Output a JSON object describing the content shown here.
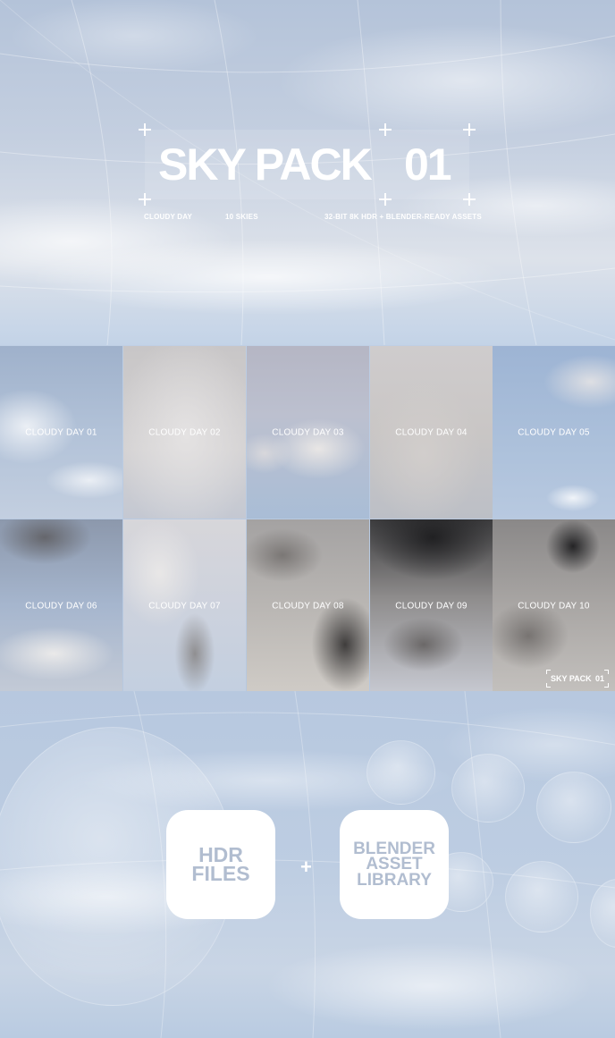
{
  "header": {
    "title_left": "SKY PACK",
    "title_right": "01",
    "subtitle_left": "CLOUDY DAY",
    "subtitle_mid": "10 SKIES",
    "subtitle_right": "32-BIT 8K HDR + BLENDER-READY ASSETS"
  },
  "tiles": [
    {
      "label": "CLOUDY DAY 01"
    },
    {
      "label": "CLOUDY DAY 02"
    },
    {
      "label": "CLOUDY DAY 03"
    },
    {
      "label": "CLOUDY DAY 04"
    },
    {
      "label": "CLOUDY DAY 05"
    },
    {
      "label": "CLOUDY DAY 06"
    },
    {
      "label": "CLOUDY DAY 07"
    },
    {
      "label": "CLOUDY DAY 08"
    },
    {
      "label": "CLOUDY DAY 09"
    },
    {
      "label": "CLOUDY DAY 10"
    }
  ],
  "watermark": {
    "left": "SKY PACK",
    "right": "01"
  },
  "footer": {
    "badge_hdr": [
      "HDR",
      "FILES"
    ],
    "plus": "+",
    "badge_blender": [
      "BLENDER",
      "ASSET",
      "LIBRARY"
    ]
  },
  "colors": {
    "badge_text": "#b1bdd0",
    "overlay_text": "#ffffff"
  }
}
